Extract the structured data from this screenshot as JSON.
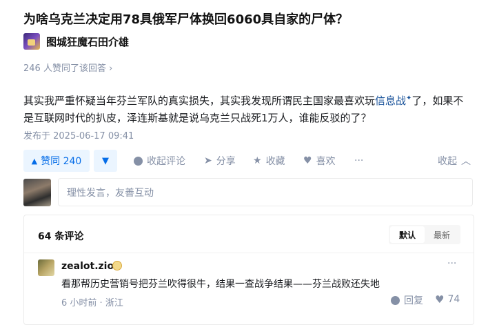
{
  "question": {
    "title": "为啥乌克兰决定用78具俄军尸体换回6060具自家的尸体？"
  },
  "author": {
    "name": "图城狂魔石田介雄",
    "avatar": "author-avatar"
  },
  "voters_text": "246 人赞同了该回答 ›",
  "answer": {
    "text_before": "其实我严重怀疑当年芬兰军队的真实损失，其实我发现所谓民主国家最喜欢玩",
    "link_text": "信息战",
    "spark_icon": "✦",
    "text_after": "了，如果不是互联网时代的扒皮，泽连斯基就是说乌克兰只战死1万人，谁能反驳的了？"
  },
  "published": "发布于 2025-06-17 09:41",
  "actions": {
    "vote_up": {
      "icon": "▲",
      "label": "赞同 240"
    },
    "vote_down": {
      "icon": "▼"
    },
    "collapse_comments": "收起评论",
    "share": "分享",
    "favorite": "收藏",
    "like": "喜欢",
    "more": "···",
    "collapse": "收起",
    "collapse_icon": "︿"
  },
  "comment_input": {
    "placeholder": "理性发言，友善互动"
  },
  "comments": {
    "count_label": "64 条评论",
    "sort": {
      "default": "默认",
      "latest": "最新",
      "selected": "默认"
    },
    "items": [
      {
        "user": "zealot.zio",
        "text": "看那帮历史营销号把芬兰吹得很牛，结果一查战争结果——芬兰战败还失地",
        "time": "6 小时前",
        "location": "浙江",
        "reply_label": "回复",
        "likes": "74",
        "more": "···"
      }
    ]
  },
  "colors": {
    "accent": "#056de8",
    "accent_bg": "#ebf5ff",
    "muted": "#8590a6",
    "link": "#175199"
  }
}
